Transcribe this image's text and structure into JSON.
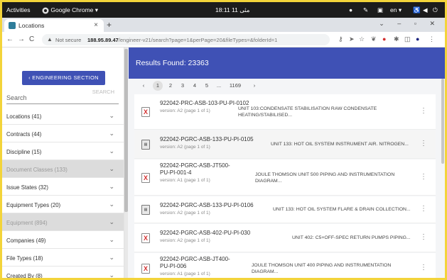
{
  "topbar": {
    "activities": "Activities",
    "app": "Google Chrome ▾",
    "clock": "18:11 11 مئى",
    "lang": "en ▾"
  },
  "browser": {
    "tab_title": "Locations",
    "tab_close": "×",
    "new_tab": "+",
    "not_secure": "Not secure",
    "url_host": "188.95.89.47",
    "url_path": "/engineer-v21/search?page=1&perPage=20&fileTypes=&folderId=1"
  },
  "sidebar": {
    "section_button": "‹  ENGINEERING SECTION",
    "search_placeholder": "Search",
    "search_button": "SEARCH",
    "facets": [
      {
        "label": "Locations (41)",
        "disabled": false
      },
      {
        "label": "Contracts (44)",
        "disabled": false
      },
      {
        "label": "Discipline (15)",
        "disabled": false
      },
      {
        "label": "Document Classes (133)",
        "disabled": true
      },
      {
        "label": "Issue States (32)",
        "disabled": false
      },
      {
        "label": "Equipment Types (20)",
        "disabled": false
      },
      {
        "label": "Equipment (894)",
        "disabled": true
      },
      {
        "label": "Companies (49)",
        "disabled": false
      },
      {
        "label": "File Types (18)",
        "disabled": false
      },
      {
        "label": "Created By (8)",
        "disabled": false
      }
    ]
  },
  "results": {
    "header": "Results Found: 23363",
    "pagination": {
      "prev": "‹",
      "pages": [
        "1",
        "2",
        "3",
        "4",
        "5",
        "...",
        "1169"
      ],
      "current": "1",
      "next": "›"
    },
    "items": [
      {
        "code": "922042-PRC-ASB-103-PU-PI-0102",
        "version": "version: A2 (page 1 of 1)",
        "description": "UNIT 103:CONDENSATE STABILISATION RAW CONDENSATE HEATING/STABILISED...",
        "icon": "pdf-file-icon"
      },
      {
        "code": "922042-PGRC-ASB-133-PU-PI-0105",
        "version": "version: A2 (page 1 of 1)",
        "description": "UNIT 133: HOT OIL SYSTEM INSTRUMENT AIR. NITROGEN...",
        "icon": "drawing-file-icon"
      },
      {
        "code": "922042-PGRC-ASB-JT500-PU-PI-001-4",
        "version": "version: A1 (page 1 of 1)",
        "description": "JOULE THOMSON UNIT 500 PIPING AND INSTRUMENTATION DIAGRAM...",
        "icon": "pdf-file-icon"
      },
      {
        "code": "922042-PGRC-ASB-133-PU-PI-0106",
        "version": "version: A2 (page 1 of 1)",
        "description": "UNIT 133: HOT OIL SYSTEM FLARE & DRAIN COLLECTION...",
        "icon": "drawing-file-icon"
      },
      {
        "code": "922042-PGRC-ASB-402-PU-PI-030",
        "version": "version: A2 (page 1 of 1)",
        "description": "UNIT 402: C5+OFF-SPEC RETURN PUMPS PIPING...",
        "icon": "pdf-file-icon"
      },
      {
        "code": "922042-PGRC-ASB-JT400-PU-PI-006",
        "version": "version: A1 (page 1 of 1)",
        "description": "JOULE THOMSON UNIT 400 PIPING AND INSTRUMENTATION DIAGRAM...",
        "icon": "pdf-file-icon"
      }
    ]
  }
}
